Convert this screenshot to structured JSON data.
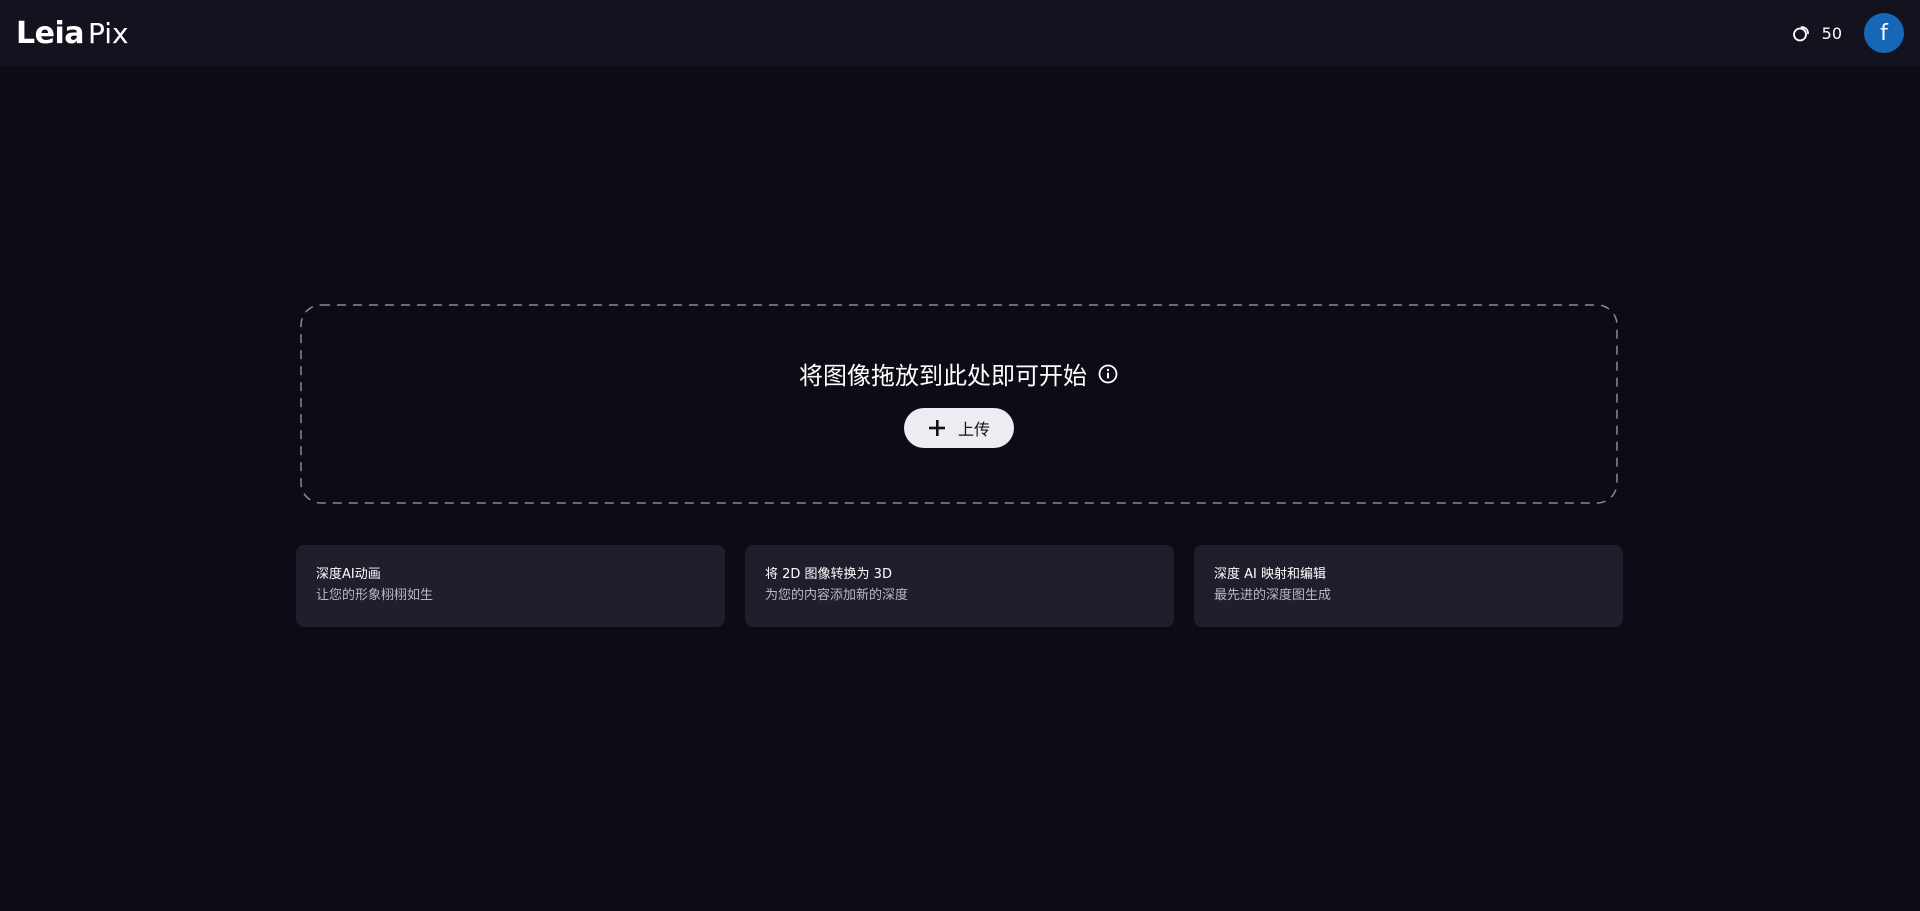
{
  "header": {
    "logo_primary": "Leia",
    "logo_secondary": "Pix",
    "credits_icon": "coins-icon",
    "credits": "50",
    "avatar_letter": "f",
    "avatar_color": "#1667b5"
  },
  "dropzone": {
    "title": "将图像拖放到此处即可开始",
    "info_icon": "info-icon",
    "upload_icon": "plus-icon",
    "upload_label": "上传"
  },
  "features": [
    {
      "title": "深度AI动画",
      "subtitle": "让您的形象栩栩如生"
    },
    {
      "title": "将 2D 图像转换为 3D",
      "subtitle": "为您的内容添加新的深度"
    },
    {
      "title": "深度 AI 映射和编辑",
      "subtitle": "最先进的深度图生成"
    }
  ],
  "colors": {
    "background": "#0c0c16",
    "header_background": "#131320",
    "card_background": "#1e1e2d",
    "upload_button": "#ececf2"
  }
}
